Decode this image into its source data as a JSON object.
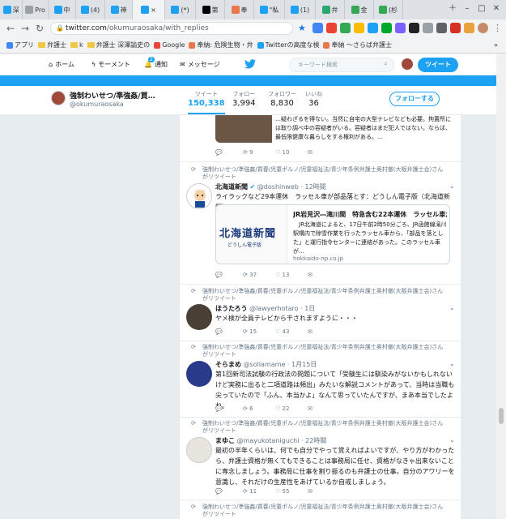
{
  "browser": {
    "tabs": [
      {
        "icon": "twitter-icon",
        "label": "深",
        "color": "#1da1f2"
      },
      {
        "icon": "page-icon",
        "label": "Pro",
        "color": "#9aa0a6"
      },
      {
        "icon": "twitter-icon",
        "label": "中",
        "color": "#1da1f2"
      },
      {
        "icon": "twitter-icon",
        "label": "(4)",
        "color": "#1da1f2"
      },
      {
        "icon": "twitter-icon",
        "label": "神",
        "color": "#1da1f2"
      },
      {
        "icon": "twitter-icon",
        "label": "×",
        "color": "#1da1f2",
        "active": true
      },
      {
        "icon": "twitter-icon",
        "label": "(*)",
        "color": "#1da1f2"
      },
      {
        "icon": "wikipedia-icon",
        "label": "第",
        "color": "#000000"
      },
      {
        "icon": "blog-icon",
        "label": "奉",
        "color": "#e8774a"
      },
      {
        "icon": "twitter-icon",
        "label": "\"私",
        "color": "#1da1f2"
      },
      {
        "icon": "twitter-icon",
        "label": "(1)",
        "color": "#1da1f2"
      },
      {
        "icon": "note-icon",
        "label": "弁",
        "color": "#2aa86f"
      },
      {
        "icon": "map-icon",
        "label": "金",
        "color": "#34a853"
      },
      {
        "icon": "map-icon",
        "label": "(杉",
        "color": "#34a853"
      }
    ],
    "url_host": "twitter.com",
    "url_path": "/okumuraosaka/with_replies",
    "bookmarks": [
      {
        "label": "アプリ",
        "icon": "apps-icon"
      },
      {
        "label": "弁護士",
        "icon": "folder-icon"
      },
      {
        "label": "k",
        "icon": "folder-icon"
      },
      {
        "label": "弁護士 深澤諭史の",
        "icon": "folder-icon"
      },
      {
        "label": "Google",
        "icon": "google-icon"
      },
      {
        "label": "奉納: 危険生物・弁",
        "icon": "blog-icon"
      },
      {
        "label": "Twitterの高度な検",
        "icon": "twitter-icon"
      },
      {
        "label": "奉納 ～さらば弁護士",
        "icon": "blog-icon"
      }
    ]
  },
  "twitter_nav": {
    "home": "ホーム",
    "moments": "モーメント",
    "notifications": "通知",
    "notif_count": "2",
    "messages": "メッセージ",
    "search_placeholder": "キーワード検索",
    "tweet_button": "ツイート"
  },
  "profile": {
    "name": "強制わいせつ/準強姦/買…",
    "handle": "@okumuraosaka",
    "stats": [
      {
        "label": "ツイート",
        "value": "150,338",
        "selected": true
      },
      {
        "label": "フォロー",
        "value": "3,994"
      },
      {
        "label": "フォロワー",
        "value": "8,830"
      },
      {
        "label": "いいね",
        "value": "36"
      }
    ],
    "follow_button": "フォローする"
  },
  "partial_top": {
    "text": "…疑わざるを得ない。当然に自宅の大型テレビなども必要。拘置所には取り調べ中の容疑者がいる。容疑者はまだ犯人ではない。ならば、最低限健康な暮らしをする権利がある。…",
    "replies": "",
    "retweets": "9",
    "likes": "10"
  },
  "tweets": [
    {
      "retweet_label": "強制わいせつ/準強姦/買春/児童ポルノ/児童福祉法/青少年条例弁護士奥村徹(大阪弁護士会)さんがリツイート",
      "name": "北海道新聞",
      "verified": "✔",
      "handle": "@doshinweb",
      "time": "12時間",
      "text": "ライラックなど29本運休　ラッセル車が部品落とす：どうしん電子版（北海道新聞）",
      "card_logo": "北海道新聞",
      "card_logo_sub": "どうしん電子版",
      "card_title": "JR岩見沢―滝川間　特急含む22本運休　ラッセル車が…",
      "card_desc": "　JR北海道によると、17日午前2時50分ごろ、JR函館線滝川駅構内で除雪作業を行ったラッセル車から、「部品を落とした」と運行指令センターに連絡があった。このラッセル車が…",
      "card_domain": "hokkaido-np.co.jp",
      "replies": "",
      "retweets": "37",
      "likes": "13"
    },
    {
      "retweet_label": "強制わいせつ/準強姦/買春/児童ポルノ/児童福祉法/青少年条例弁護士奥村徹(大阪弁護士会)さんがリツイート",
      "name": "ほうたろう",
      "handle": "@lawyerhotaro",
      "time": "1日",
      "text": "ヤメ検が全員テレビから干されますように・・・",
      "replies": "",
      "retweets": "15",
      "likes": "43"
    },
    {
      "retweet_label": "強制わいせつ/準強姦/買春/児童ポルノ/児童福祉法/青少年条例弁護士奥村徹(大阪弁護士会)さんがリツイート",
      "name": "そらまめ",
      "handle": "@sollamame",
      "time": "1月15日",
      "text": "第1回新司法試験の行政法の問題について「受験生には馴染みがないかもしれないけど実務に出ると二項道路は頻出」みたいな解説コメントがあって、当時は当職も尖っていたので「ふん、本当かよ」なんて思っていたんですが、まあ本当でしたよね。",
      "replies": "",
      "retweets": "6",
      "likes": "22"
    },
    {
      "retweet_label": "強制わいせつ/準強姦/買春/児童ポルノ/児童福祉法/青少年条例弁護士奥村徹(大阪弁護士会)さんがリツイート",
      "name": "まゆこ",
      "handle": "@mayukotaniguchi",
      "time": "22時間",
      "text": "最初の半年くらいは、何でも自分でやって覚えればよいですが、やり方がわかったら、弁護士資格が無くてもできることは事務局に任せ、資格がなきゃ出来ないことに専念しましょう。事務局に仕事を割り振るのも弁護士の仕事。自分のアワリーを意識し、それだけの生産性をあげているか自戒しましょう。",
      "replies": "",
      "retweets": "11",
      "likes": "55"
    },
    {
      "retweet_label": "強制わいせつ/準強姦/買春/児童ポルノ/児童福祉法/青少年条例弁護士奥村徹(大阪弁護士会)さんがリツイート"
    }
  ],
  "colors": {
    "twitter_blue": "#1da1f2",
    "text": "#14171a",
    "muted": "#657786",
    "border": "#e6ecf0"
  }
}
